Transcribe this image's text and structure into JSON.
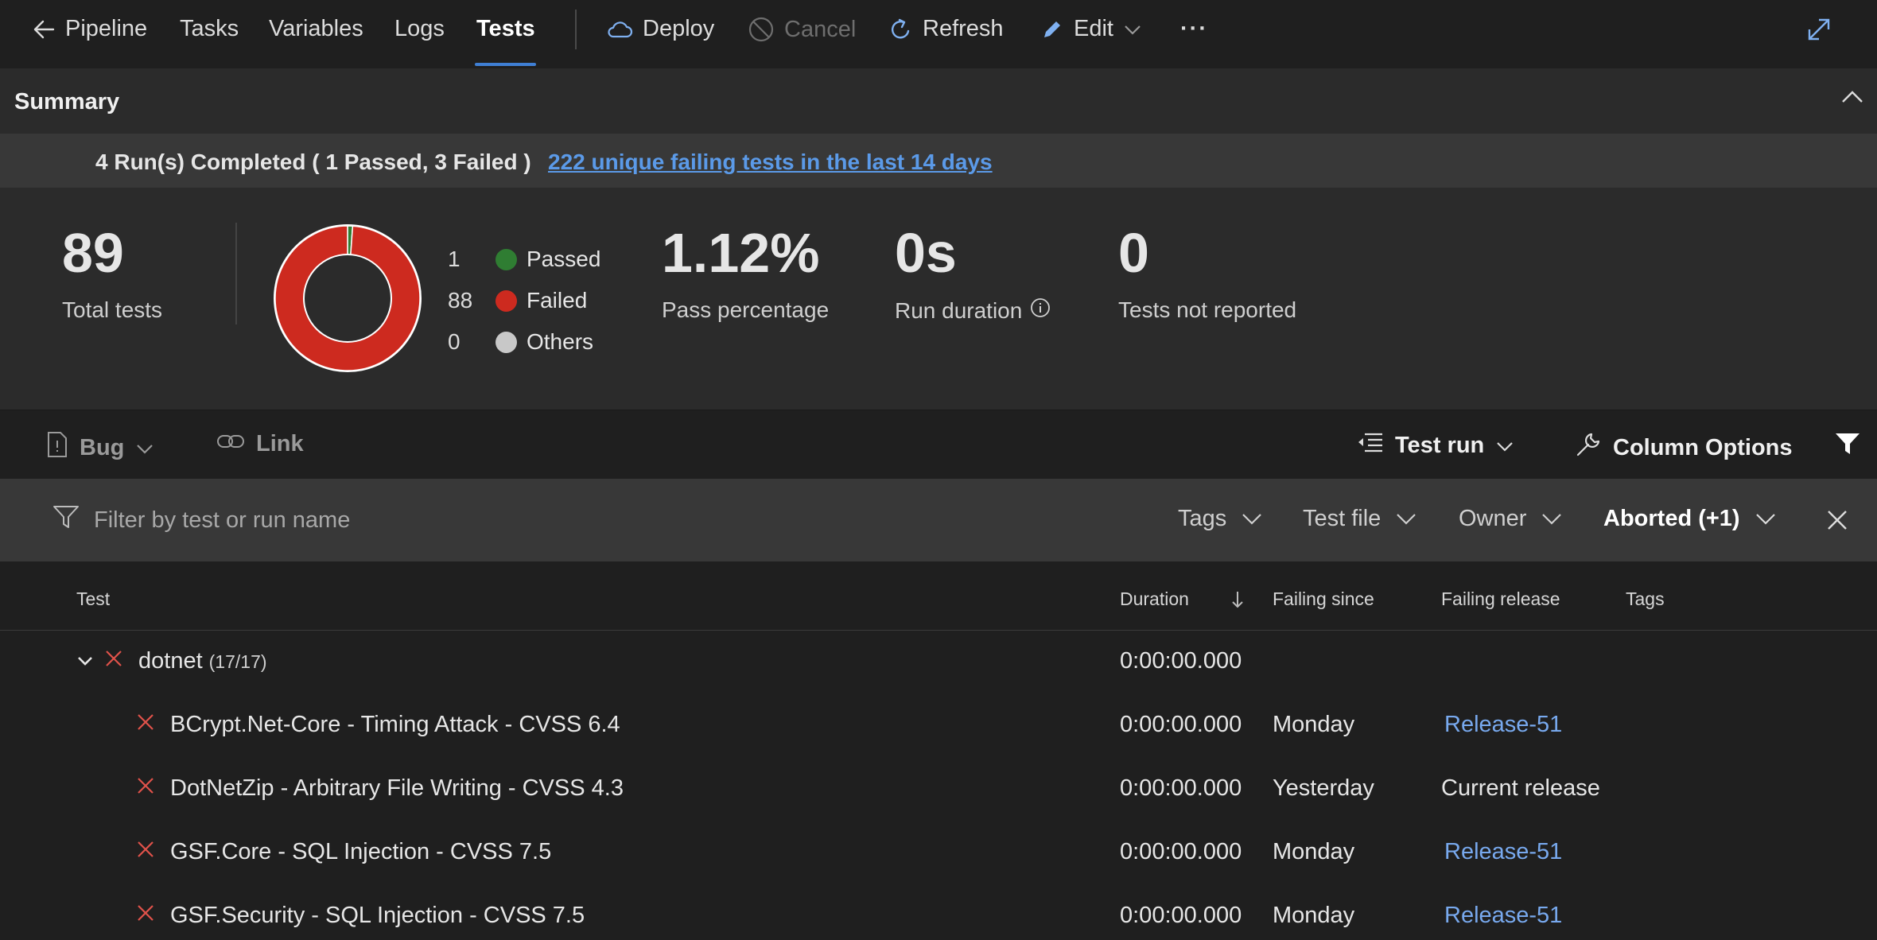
{
  "nav": {
    "back_label": "Pipeline",
    "tabs": [
      {
        "label": "Tasks"
      },
      {
        "label": "Variables"
      },
      {
        "label": "Logs"
      },
      {
        "label": "Tests",
        "active": true
      }
    ],
    "deploy_label": "Deploy",
    "cancel_label": "Cancel",
    "refresh_label": "Refresh",
    "edit_label": "Edit",
    "more_label": "···"
  },
  "summary": {
    "title": "Summary",
    "runs_text": "4 Run(s) Completed ( 1 Passed, 3 Failed )",
    "failing_link": "222 unique failing tests in the last 14 days",
    "total_tests": "89",
    "total_tests_label": "Total tests",
    "pass_percentage": "1.12%",
    "pass_percentage_label": "Pass percentage",
    "run_duration": "0s",
    "run_duration_label": "Run duration",
    "not_reported": "0",
    "not_reported_label": "Tests not reported",
    "legend": [
      {
        "count": "1",
        "label": "Passed",
        "color": "#2f7d32"
      },
      {
        "count": "88",
        "label": "Failed",
        "color": "#cd2a1f"
      },
      {
        "count": "0",
        "label": "Others",
        "color": "#c8c8c8"
      }
    ]
  },
  "chart_data": {
    "type": "pie",
    "donut": true,
    "categories": [
      "Passed",
      "Failed",
      "Others"
    ],
    "values": [
      1,
      88,
      0
    ],
    "colors": [
      "#2f7d32",
      "#cd2a1f",
      "#c8c8c8"
    ]
  },
  "toolbar": {
    "bug_label": "Bug",
    "link_label": "Link",
    "test_run_label": "Test run",
    "column_options_label": "Column Options"
  },
  "filter": {
    "placeholder": "Filter by test or run name",
    "tags_label": "Tags",
    "test_file_label": "Test file",
    "owner_label": "Owner",
    "outcome_label": "Aborted (+1)"
  },
  "table": {
    "headers": {
      "test": "Test",
      "duration": "Duration",
      "failing_since": "Failing since",
      "failing_release": "Failing release",
      "tags": "Tags"
    },
    "group": {
      "name": "dotnet",
      "count": "(17/17)",
      "duration": "0:00:00.000"
    },
    "rows": [
      {
        "name": "BCrypt.Net-Core - Timing Attack - CVSS 6.4",
        "duration": "0:00:00.000",
        "since": "Monday",
        "release": "Release-51",
        "release_is_link": true
      },
      {
        "name": "DotNetZip - Arbitrary File Writing - CVSS 4.3",
        "duration": "0:00:00.000",
        "since": "Yesterday",
        "release": "Current release",
        "release_is_link": false
      },
      {
        "name": "GSF.Core - SQL Injection - CVSS 7.5",
        "duration": "0:00:00.000",
        "since": "Monday",
        "release": "Release-51",
        "release_is_link": true
      },
      {
        "name": "GSF.Security - SQL Injection - CVSS 7.5",
        "duration": "0:00:00.000",
        "since": "Monday",
        "release": "Release-51",
        "release_is_link": true
      }
    ]
  }
}
